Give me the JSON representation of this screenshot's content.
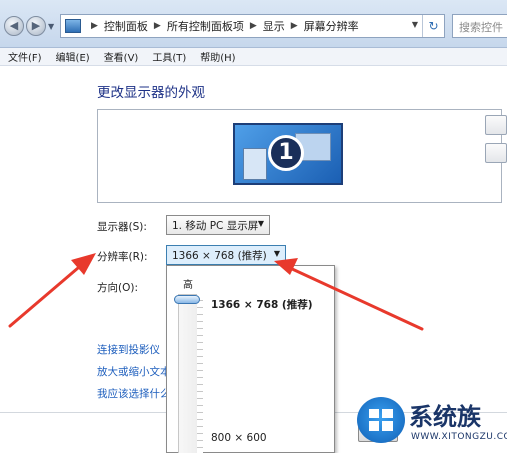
{
  "address": {
    "crumbs": [
      "控制面板",
      "所有控制面板项",
      "显示",
      "屏幕分辨率"
    ],
    "search_placeholder": "搜索控件"
  },
  "menu": [
    "文件(F)",
    "编辑(E)",
    "查看(V)",
    "工具(T)",
    "帮助(H)"
  ],
  "main": {
    "title": "更改显示器的外观",
    "monitor_number": "1",
    "display_label": "显示器(S):",
    "display_value": "1. 移动 PC 显示屏",
    "resolution_label": "分辨率(R):",
    "resolution_value": "1366 × 768 (推荐)",
    "orientation_label": "方向(O):",
    "links": [
      "连接到投影仪（",
      "放大或缩小文本",
      "我应该选择什么"
    ]
  },
  "dropdown": {
    "high_label": "高",
    "top_option": "1366 × 768 (推荐)",
    "bottom_option": "800 × 600",
    "slider_level": 1.0
  },
  "watermark": {
    "text_cn": "系统族",
    "text_en": "WWW.XITONGZU.COM"
  },
  "annotation_color": "#e8392c"
}
